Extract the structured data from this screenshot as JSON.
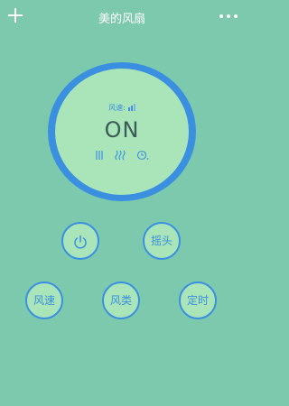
{
  "header": {
    "title": "美的风扇",
    "add_icon": "plus-icon",
    "more_icon": "more-dots-icon"
  },
  "dial": {
    "speed_label": "风速:",
    "speed_icon": "signal-bars-icon",
    "status": "ON",
    "indicator_icons": [
      "vertical-lines-icon",
      "wavy-lines-icon",
      "clock-icon"
    ]
  },
  "controls": {
    "power_icon": "power-icon",
    "swing_label": "摇头",
    "speed_label": "风速",
    "mode_label": "风类",
    "timer_label": "定时"
  },
  "colors": {
    "background": "#7cc9ae",
    "accent": "#3b8fe0",
    "face": "#a9e5b8",
    "status_text": "#3c5a56"
  }
}
